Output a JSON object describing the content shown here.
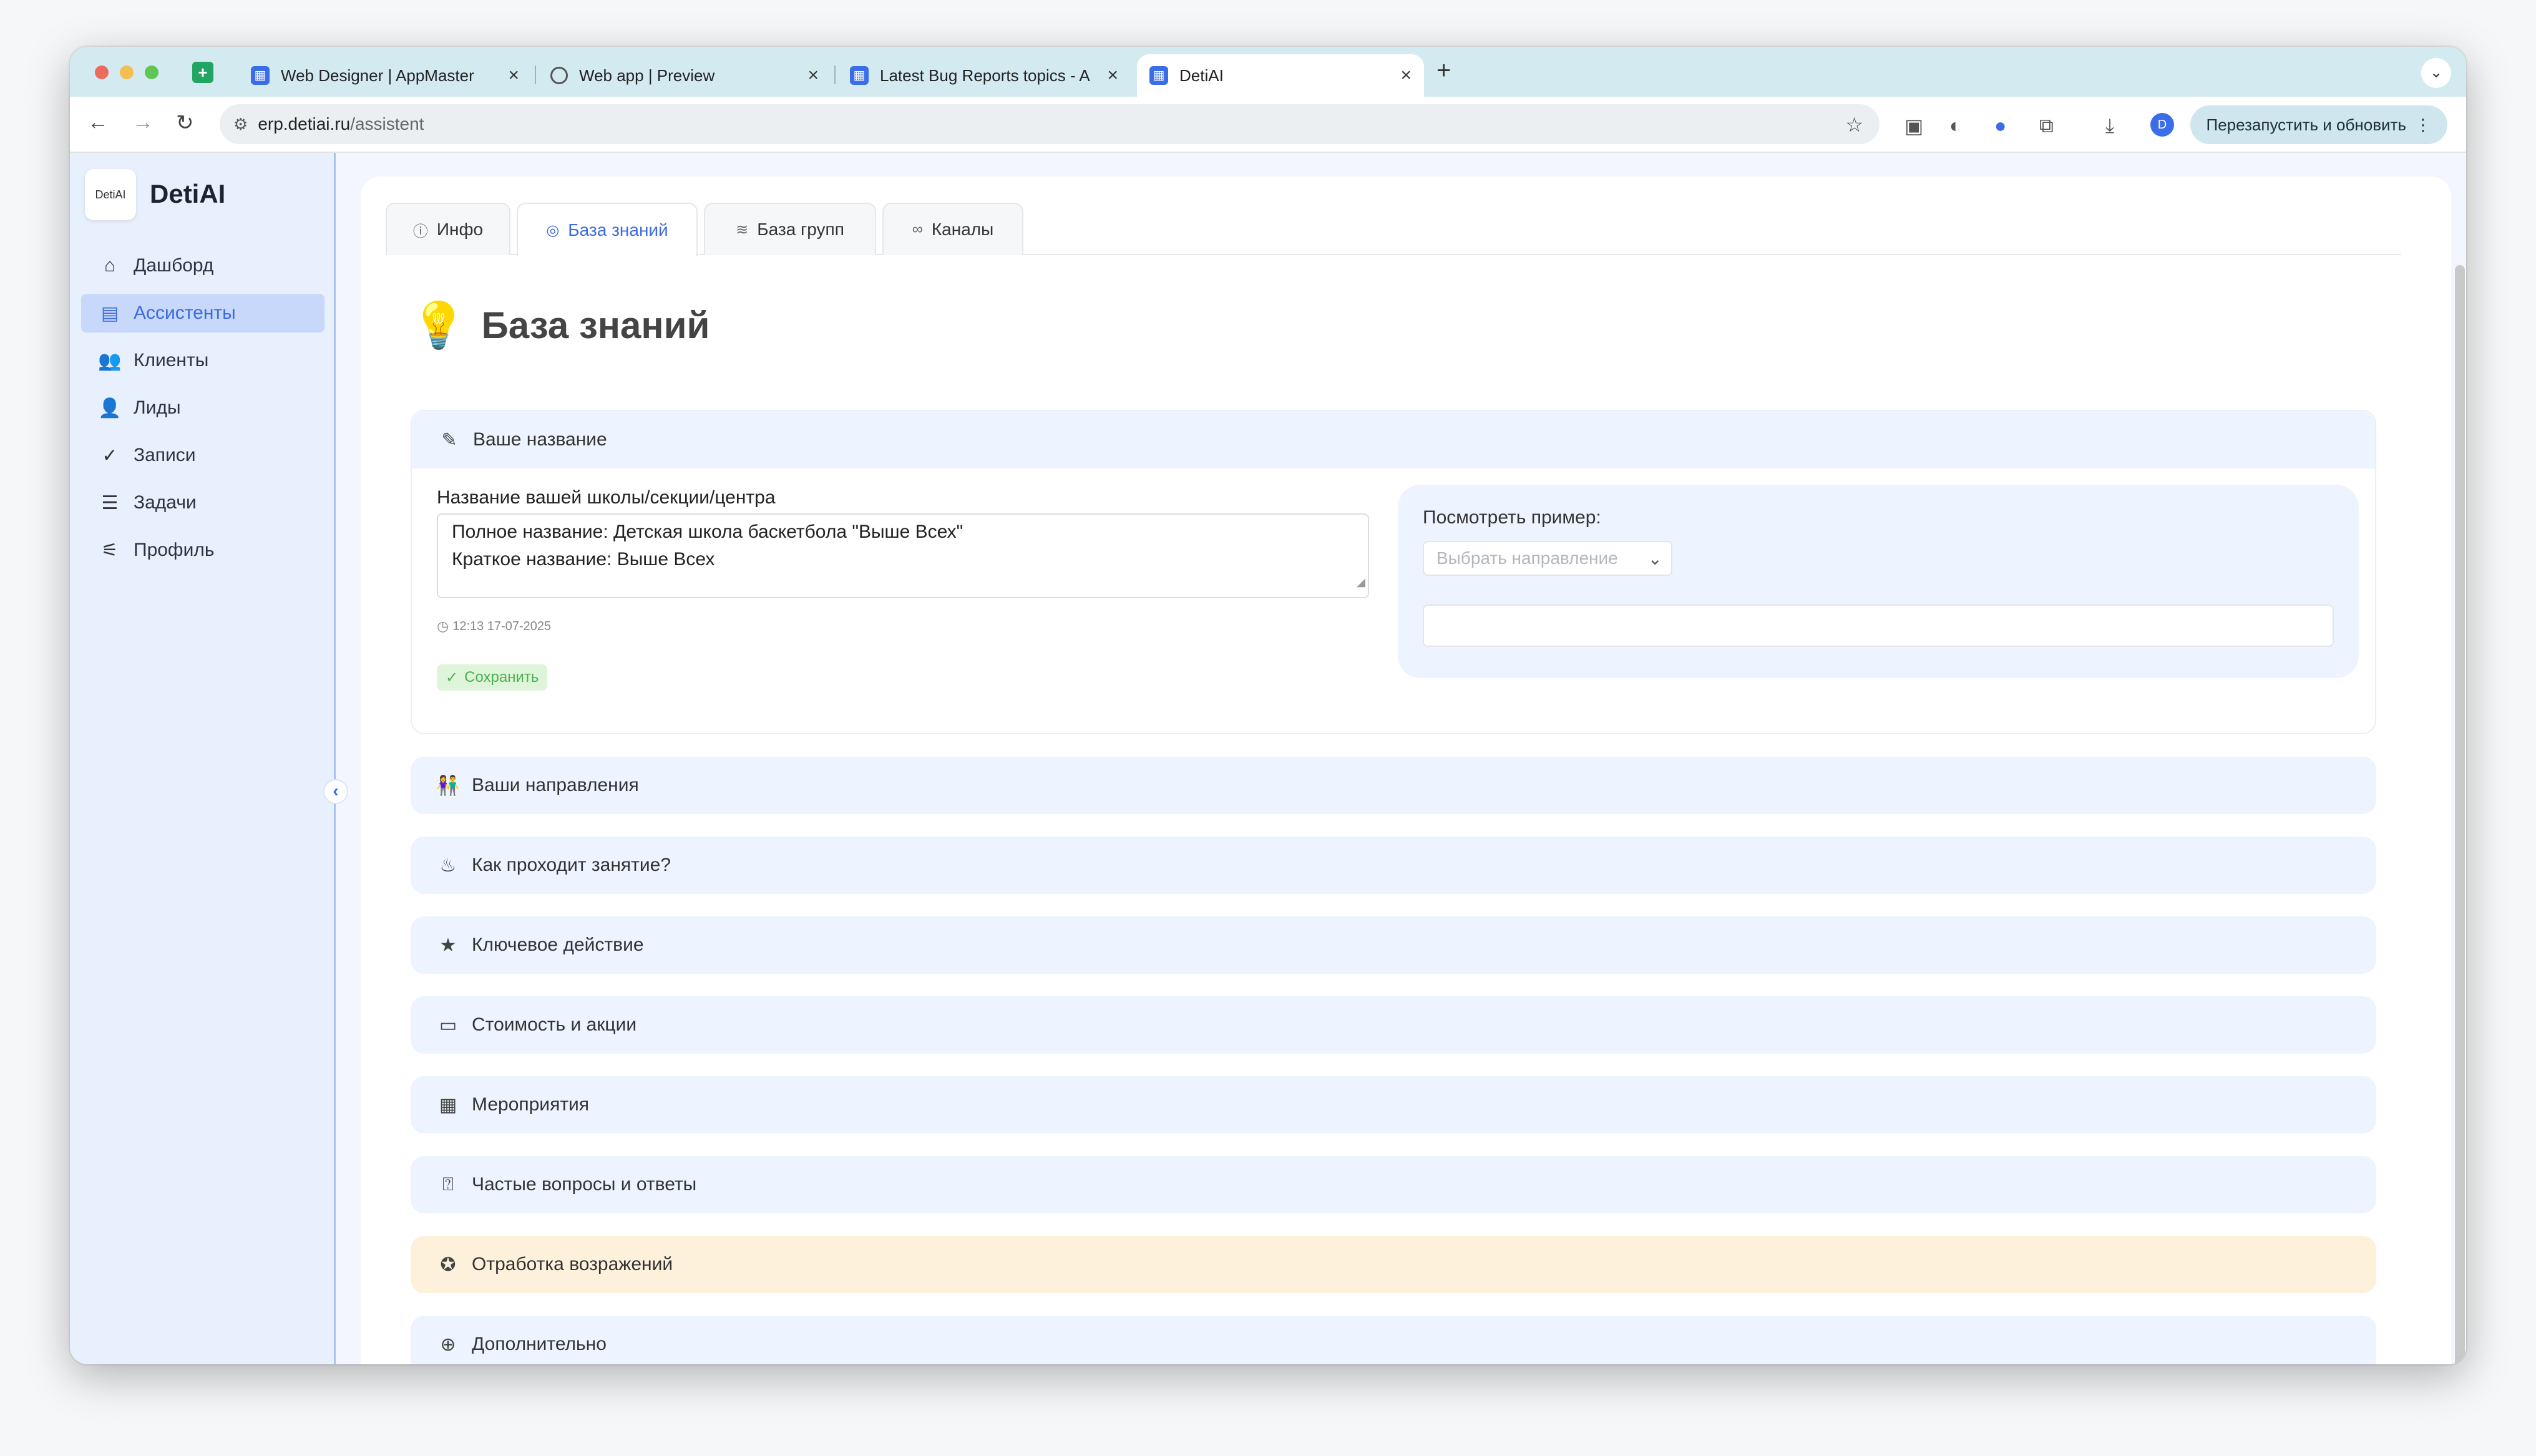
{
  "browser": {
    "tabs": [
      {
        "title": "Web Designer | AppMaster",
        "favicon": "appmaster-icon"
      },
      {
        "title": "Web app | Preview",
        "favicon": "globe-icon"
      },
      {
        "title": "Latest Bug Reports topics - A",
        "favicon": "appmaster-icon"
      },
      {
        "title": "DetiAI",
        "favicon": "appmaster-icon"
      }
    ],
    "url_host": "erp.detiai.ru",
    "url_path": "/assistent",
    "relaunch_label": "Перезапустить и обновить",
    "profile_initial": "D"
  },
  "sidebar": {
    "logo_badge": "DetiAI",
    "app_name": "DetiAI",
    "items": [
      {
        "label": "Дашборд",
        "icon": "home-icon"
      },
      {
        "label": "Ассистенты",
        "icon": "id-card-icon",
        "active": true
      },
      {
        "label": "Клиенты",
        "icon": "users-icon"
      },
      {
        "label": "Лиды",
        "icon": "user-icon"
      },
      {
        "label": "Записи",
        "icon": "check-icon"
      },
      {
        "label": "Задачи",
        "icon": "list-icon"
      },
      {
        "label": "Профиль",
        "icon": "sliders-icon"
      }
    ]
  },
  "page_tabs": [
    {
      "label": "Инфо",
      "icon": "info-icon"
    },
    {
      "label": "База знаний",
      "icon": "brain-icon",
      "active": true
    },
    {
      "label": "База групп",
      "icon": "database-icon"
    },
    {
      "label": "Каналы",
      "icon": "link-icon"
    }
  ],
  "page_title": "База знаний",
  "name_section": {
    "header": "Ваше название",
    "field_label": "Название вашей школы/секции/центра",
    "field_value": "Полное название: Детская школа баскетбола \"Выше Всех\"\nКраткое название: Выше Всех",
    "timestamp": "12:13 17-07-2025",
    "save_label": "Сохранить",
    "example_label": "Посмотреть пример:",
    "example_select_placeholder": "Выбрать направление"
  },
  "sections": [
    {
      "label": "Ваши направления",
      "icon": "people-icon"
    },
    {
      "label": "Как проходит занятие?",
      "icon": "flame-icon"
    },
    {
      "label": "Ключевое действие",
      "icon": "star-icon"
    },
    {
      "label": "Стоимость и акции",
      "icon": "money-icon"
    },
    {
      "label": "Мероприятия",
      "icon": "calendar-icon"
    },
    {
      "label": "Частые вопросы и ответы",
      "icon": "question-icon"
    },
    {
      "label": "Отработка возражений",
      "icon": "badge-icon",
      "highlight": "#fdf1dc"
    },
    {
      "label": "Дополнительно",
      "icon": "plus-circle-icon"
    }
  ]
}
